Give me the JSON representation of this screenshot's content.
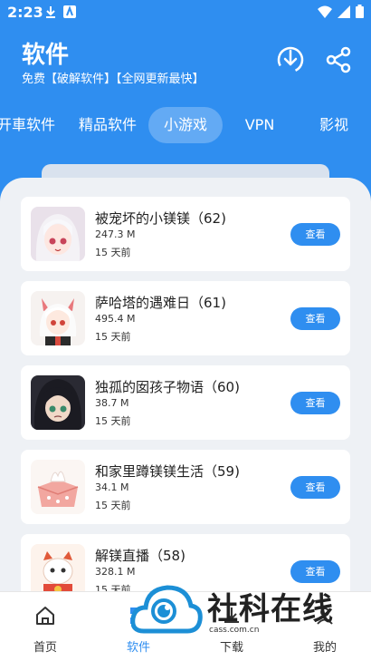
{
  "status_bar": {
    "time": "2:23",
    "icons": [
      "download-icon",
      "app-icon",
      "wifi-icon",
      "signal-icon",
      "battery-icon"
    ]
  },
  "header": {
    "title": "软件",
    "subtitle": "免费【破解软件】【全网更新最快】",
    "actions": [
      "download-icon",
      "share-icon"
    ]
  },
  "tabs": [
    {
      "label": "开車软件",
      "active": false
    },
    {
      "label": "精品软件",
      "active": false
    },
    {
      "label": "小游戏",
      "active": true
    },
    {
      "label": "VPN",
      "active": false
    },
    {
      "label": "影视",
      "active": false
    }
  ],
  "games": [
    {
      "name": "被宠坏的小镁镁（62)",
      "size": "247.3 M",
      "date": "15 天前",
      "button": "查看"
    },
    {
      "name": "萨哈塔的遇难日（61)",
      "size": "495.4 M",
      "date": "15 天前",
      "button": "查看"
    },
    {
      "name": "独孤的囡孩子物语（60)",
      "size": "38.7 M",
      "date": "15 天前",
      "button": "查看"
    },
    {
      "name": "和家里蹲镁镁生活（59)",
      "size": "34.1 M",
      "date": "15 天前",
      "button": "查看"
    },
    {
      "name": "解镁直播（58)",
      "size": "328.1 M",
      "date": "15 天前",
      "button": "查看"
    }
  ],
  "bottom_nav": [
    {
      "label": "首页",
      "icon": "home-icon"
    },
    {
      "label": "软件",
      "icon": "apps-icon"
    },
    {
      "label": "下载",
      "icon": "download-icon"
    },
    {
      "label": "我的",
      "icon": "user-icon"
    }
  ],
  "watermark": {
    "text": "社科在线",
    "url": "cass.com.cn"
  },
  "colors": {
    "primary": "#2f8ef0",
    "card_bg": "#eef1f5",
    "text_dark": "#222222"
  }
}
